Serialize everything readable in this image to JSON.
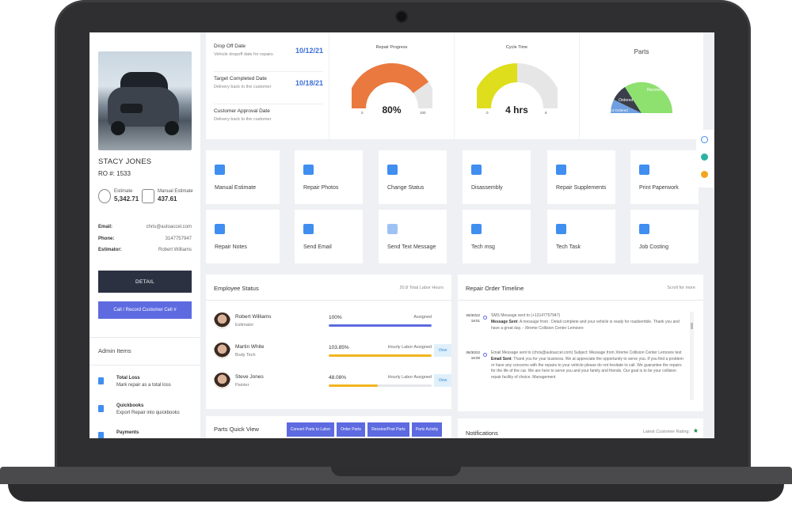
{
  "customer": {
    "name": "STACY JONES",
    "ro": "RO #: 1533",
    "estimate_label": "Estimate",
    "estimate_value": "5,342.71",
    "manual_estimate_label": "Manual Estimate",
    "manual_estimate_value": "437.61",
    "email_label": "Email:",
    "email_value": "chris@autoaccel.com",
    "phone_label": "Phone:",
    "phone_value": "3147757947",
    "estimator_label": "Estimator:",
    "estimator_value": "Robert Williams",
    "detail_button": "DETAIL",
    "call_button": "Call / Record Customer Cell #"
  },
  "admin": {
    "title": "Admin Items",
    "items": [
      {
        "title": "Total Loss",
        "desc": "Mark repair as a total loss"
      },
      {
        "title": "Quickbooks",
        "desc": "Export Repair into quickbooks"
      },
      {
        "title": "Payments",
        "desc": ""
      }
    ]
  },
  "dates": [
    {
      "label": "Drop Off Date",
      "sub": "Vehicle dropoff date for repairs",
      "value": "10/12/21"
    },
    {
      "label": "Target Completed Date",
      "sub": "Delivery back to the customer",
      "value": "10/18/21"
    },
    {
      "label": "Customer Approval Date",
      "sub": "Delivery back to the customer",
      "value": ""
    }
  ],
  "gauges": {
    "repair_progress": {
      "title": "Repair Progress",
      "display": "80%",
      "min": "0",
      "max": "100",
      "fraction": 0.8,
      "color": "#e9793f"
    },
    "cycle_time": {
      "title": "Cycle Time",
      "display": "4 hrs",
      "min": "0",
      "max": "8",
      "fraction": 0.5,
      "color": "#dede1c"
    }
  },
  "parts_chart": {
    "title": "Parts",
    "labels": {
      "received": "Received",
      "ordered": "Ordered",
      "not_ordered": "Not Ordered"
    },
    "colors": {
      "received": "#8ee06f",
      "ordered": "#3a3f4b",
      "not_ordered": "#6f9fe0"
    }
  },
  "actions": [
    {
      "label": "Manual Estimate",
      "icon": "hammer-icon",
      "color": "#3f8ef0"
    },
    {
      "label": "Repair Photos",
      "icon": "camera-icon",
      "color": "#3f8ef0"
    },
    {
      "label": "Change Status",
      "icon": "status-icon",
      "color": "#3f8ef0"
    },
    {
      "label": "Disassembly",
      "icon": "shield-icon",
      "color": "#3f8ef0"
    },
    {
      "label": "Repair Supplements",
      "icon": "alert-icon",
      "color": "#3f8ef0"
    },
    {
      "label": "Print Paperwork",
      "icon": "print-icon",
      "color": "#3f8ef0"
    },
    {
      "label": "Repair Notes",
      "icon": "folder-icon",
      "color": "#3f8ef0"
    },
    {
      "label": "Send Email",
      "icon": "keyboard-icon",
      "color": "#3f8ef0"
    },
    {
      "label": "Send Text Message",
      "icon": "chat-icon",
      "color": "#9ec2f4"
    },
    {
      "label": "Tech msg",
      "icon": "edit-icon",
      "color": "#3f8ef0"
    },
    {
      "label": "Tech Task",
      "icon": "user-add-icon",
      "color": "#3f8ef0"
    },
    {
      "label": "Job Costing",
      "icon": "safe-icon",
      "color": "#3f8ef0"
    }
  ],
  "employee_status": {
    "title": "Employee Status",
    "meta": "20.8 Total Labor Hours",
    "view_label": "View",
    "employees": [
      {
        "name": "Robert Williams",
        "role": "Estimator",
        "percent": "100%",
        "status": "Assigned",
        "fraction": 1.0,
        "color": "#5d6ae0"
      },
      {
        "name": "Martin White",
        "role": "Body Tech",
        "percent": "103.85%",
        "status": "Hourly Labor Assigned",
        "fraction": 1.0,
        "color": "#f2b51f"
      },
      {
        "name": "Steve Jones",
        "role": "Painter",
        "percent": "48.08%",
        "status": "Hourly Labor Assigned",
        "fraction": 0.48,
        "color": "#f2b51f"
      }
    ]
  },
  "timeline": {
    "title": "Repair Order Timeline",
    "meta": "Scroll for more",
    "entries": [
      {
        "date": "06/30/22",
        "time": "19:01",
        "line1": "SMS Message sent to (+13147757947)",
        "bold": "Message Sent",
        "rest": ": A message from : Detail complete and your vehicle is ready for roadsemble. Thank you and have a great day. - Xtreme Collision Center Lemoore"
      },
      {
        "date": "06/30/22",
        "time": "18:00",
        "line1": "Email Message sent to (chris@autoaccel.com) Subject: Message from Xtreme Collision Center Lemoore test",
        "bold": "Email Sent",
        "rest": ": Thank you for your business. We at appreciate the opportunity to serve you. If you find a problem or have any concerns with the repairs to your vehicle please do not hesitate to call. We guarantee the repairs for the life of the car. We are here to serve you and your family and friends. Our goal is to be your collision repair facility of choice. Management"
      }
    ]
  },
  "parts_quick_view": {
    "title": "Parts Quick View",
    "buttons": [
      "Convert Parts to Labor",
      "Order Parts",
      "Receive/Post Parts",
      "Parts Activity"
    ]
  },
  "notifications": {
    "title": "Notifications",
    "meta": "Latest Customer Rating:"
  }
}
